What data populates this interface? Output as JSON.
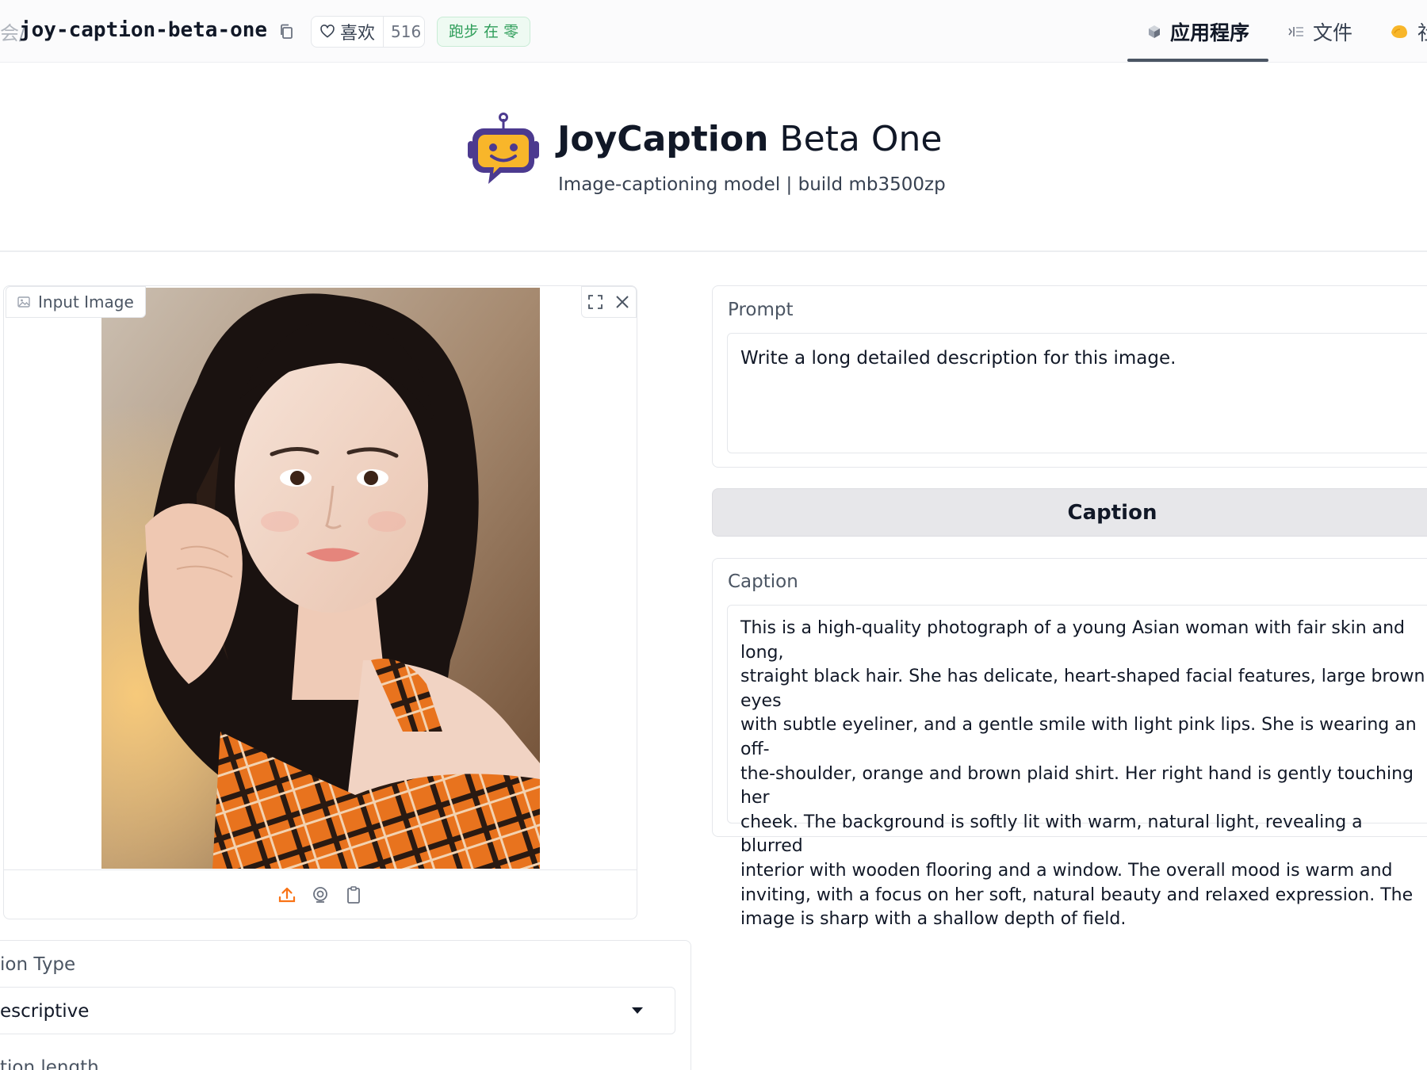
{
  "topbar": {
    "breadcrumb_separator": "/",
    "repo_name": "joy-caption-beta-one",
    "like_label": "喜欢",
    "like_count": "516",
    "status_badge": "跑步 在 零",
    "tabs": [
      {
        "label": "应用程序",
        "icon": "app-cube-icon",
        "active": true
      },
      {
        "label": "文件",
        "icon": "files-icon",
        "active": false
      },
      {
        "label": "社",
        "icon": "community-icon",
        "active": false
      }
    ]
  },
  "header": {
    "title_bold": "JoyCaption",
    "title_rest": " Beta One",
    "subtitle": "Image-captioning model  |  build mb3500zp",
    "logo_icon": "robot-chat-logo"
  },
  "image_input": {
    "label": "Input Image",
    "footer_icons": [
      "upload-icon",
      "webcam-icon",
      "clipboard-icon"
    ]
  },
  "caption_type": {
    "label": "ion Type",
    "value": "escriptive",
    "next_label": "tion length"
  },
  "prompt": {
    "label": "Prompt",
    "value": "Write a long detailed description for this image."
  },
  "caption_button": {
    "label": "Caption"
  },
  "caption_output": {
    "label": "Caption",
    "lines": [
      "This is a high-quality photograph of a young Asian woman with fair skin and long,",
      "straight black hair. She has delicate, heart-shaped facial features, large brown eyes",
      "with subtle eyeliner, and a gentle smile with light pink lips. She is wearing an off-",
      "the-shoulder, orange and brown plaid shirt. Her right hand is gently touching her",
      "cheek. The background is softly lit with warm, natural light, revealing a blurred",
      "interior with wooden flooring and a window. The overall mood is warm and",
      "inviting, with a focus on her soft, natural beauty and relaxed expression. The",
      "image is sharp with a shallow depth of field."
    ]
  },
  "colors": {
    "accent_orange": "#f97316",
    "badge_green": "#2f9e5a",
    "logo_purple": "#4c3a8f",
    "logo_yellow": "#f8b62a"
  }
}
